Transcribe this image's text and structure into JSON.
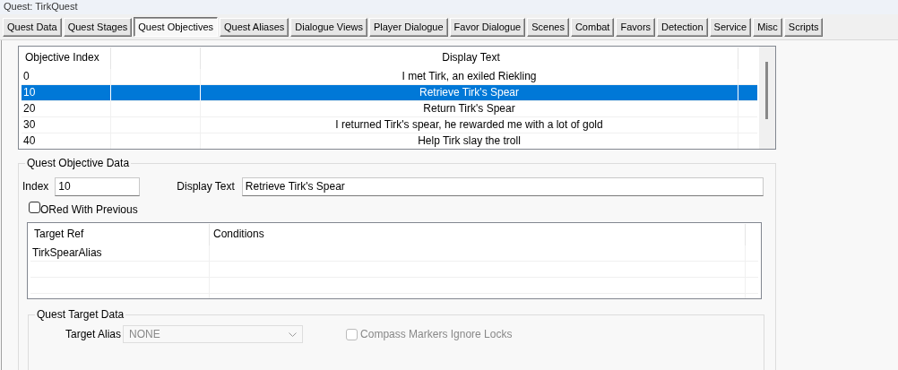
{
  "window": {
    "title": "Quest: TirkQuest"
  },
  "tabs": [
    {
      "label": "Quest Data",
      "selected": false
    },
    {
      "label": "Quest Stages",
      "selected": false
    },
    {
      "label": "Quest Objectives",
      "selected": true
    },
    {
      "label": "Quest Aliases",
      "selected": false
    },
    {
      "label": "Dialogue Views",
      "selected": false
    },
    {
      "label": "Player Dialogue",
      "selected": false
    },
    {
      "label": "Favor Dialogue",
      "selected": false
    },
    {
      "label": "Scenes",
      "selected": false
    },
    {
      "label": "Combat",
      "selected": false
    },
    {
      "label": "Favors",
      "selected": false
    },
    {
      "label": "Detection",
      "selected": false
    },
    {
      "label": "Service",
      "selected": false
    },
    {
      "label": "Misc",
      "selected": false
    },
    {
      "label": "Scripts",
      "selected": false
    }
  ],
  "objectives": {
    "column_1": "Objective Index",
    "column_3": "Display Text",
    "rows": [
      {
        "index": "0",
        "display_text": "I met Tirk, an exiled Riekling",
        "selected": false
      },
      {
        "index": "10",
        "display_text": "Retrieve Tirk's Spear",
        "selected": true
      },
      {
        "index": "20",
        "display_text": "Return Tirk's Spear",
        "selected": false
      },
      {
        "index": "30",
        "display_text": "I returned Tirk's spear, he rewarded me with a lot of gold",
        "selected": false
      },
      {
        "index": "40",
        "display_text": "Help Tirk slay the troll",
        "selected": false
      }
    ]
  },
  "quest_objective_data": {
    "title": "Quest Objective Data",
    "index": {
      "label": "Index",
      "value": "10"
    },
    "display_text": {
      "label": "Display Text",
      "value": "Retrieve Tirk's Spear"
    },
    "ored_with_previous": {
      "label": "ORed With Previous",
      "checked": false,
      "disabled": false
    },
    "targets": {
      "column_1": "Target Ref",
      "column_2": "Conditions",
      "rows": [
        {
          "target_ref": "TirkSpearAlias"
        }
      ]
    },
    "quest_target_data": {
      "title": "Quest Target Data",
      "target_alias": {
        "label": "Target Alias",
        "value": "NONE",
        "disabled": true
      },
      "compass_markers_ignore_locks": {
        "label": "Compass Markers Ignore Locks",
        "checked": false,
        "disabled": true
      }
    }
  }
}
